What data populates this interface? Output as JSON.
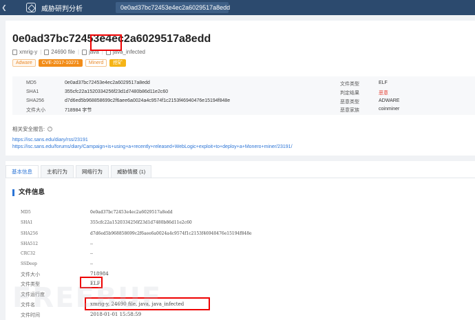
{
  "topbar": {
    "back_icon": "chevron-left-icon",
    "app_title": "威胁研判分析",
    "search_value": "0e0ad37bc72453e4ec2a6029517a8edd"
  },
  "header": {
    "title": "0e0ad37bc72453e4ec2a6029517a8edd",
    "meta": {
      "name": "xmrig-y",
      "type": "24690 file",
      "lang": "java",
      "tag": "java_infected"
    },
    "tags": [
      "Adware",
      "CVE-2017-10271",
      "Minerd",
      "挖矿"
    ]
  },
  "file_info_summary": {
    "left": [
      {
        "label": "MD5",
        "value": "0e0ad37bc72453e4ec2a6029517a8edd"
      },
      {
        "label": "SHA1",
        "value": "355cfc22a1520334256f23d1d7480b86d11e2c60"
      },
      {
        "label": "SHA256",
        "value": "d7d6ed5b968858699c2f6aee6a0024a4c9574f1c2153f46940476e15194f848e"
      },
      {
        "label": "文件大小",
        "value": "718984 字节"
      }
    ],
    "right": [
      {
        "label": "文件类型",
        "value": "ELF"
      },
      {
        "label": "判定结果",
        "value": "恶意"
      },
      {
        "label": "恶意类型",
        "value": "ADWARE"
      },
      {
        "label": "恶意家族",
        "value": "coinminer"
      }
    ]
  },
  "reports": {
    "label": "相关安全报告:",
    "links": [
      "https://isc.sans.edu/diary/rss/23191",
      "https://isc.sans.edu/forums/diary/Campaign+is+using+a+recently+released+WebLogic+exploit+to+deploy+a+Monero+miner/23191/"
    ]
  },
  "tabs": [
    "基本信息",
    "主机行为",
    "网络行为",
    "威胁情报 (1)"
  ],
  "section": {
    "title": "文件信息",
    "rows": [
      {
        "label": "MD5",
        "value": "0e0ad37bc72453e4ec2a6029517a8edd"
      },
      {
        "label": "SHA1",
        "value": "355cfc22a1520334256f23d1d7480b86d11e2c60"
      },
      {
        "label": "SHA256",
        "value": "d7d6ed5b968858699c2f6aee6a0024a4c9574f1c2153f46940476e15194f848e"
      },
      {
        "label": "SHA512",
        "value": "--"
      },
      {
        "label": "CRC32",
        "value": "--"
      },
      {
        "label": "SSDeep",
        "value": "--"
      },
      {
        "label": "文件大小",
        "value": "718984"
      },
      {
        "label": "文件类型",
        "value": "ELF"
      },
      {
        "label": "文件运行度",
        "value": ""
      },
      {
        "label": "文件名",
        "value": "xmrig-y, 24690 file, java, java_infected"
      },
      {
        "label": "文件时间",
        "value": "2018-01-01 15:58:59"
      }
    ]
  },
  "watermark": "FREEBUF",
  "colors": {
    "accent": "#2b74d6",
    "topbar": "#2c4a6e",
    "danger": "#e53c2e",
    "annotation": "#ee0000"
  }
}
